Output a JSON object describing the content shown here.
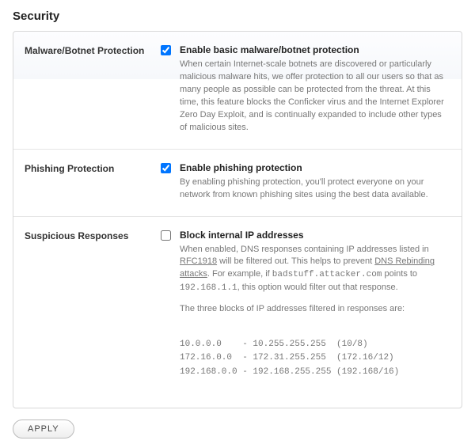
{
  "title": "Security",
  "sections": {
    "malware": {
      "label": "Malware/Botnet Protection",
      "checked": true,
      "opt_title": "Enable basic malware/botnet protection",
      "opt_desc": "When certain Internet-scale botnets are discovered or particularly malicious malware hits, we offer protection to all our users so that as many people as possible can be protected from the threat. At this time, this feature blocks the Conficker virus and the Internet Explorer Zero Day Exploit, and is continually expanded to include other types of malicious sites."
    },
    "phishing": {
      "label": "Phishing Protection",
      "checked": true,
      "opt_title": "Enable phishing protection",
      "opt_desc": "By enabling phishing protection, you'll protect everyone on your network from known phishing sites using the best data available."
    },
    "suspicious": {
      "label": "Suspicious Responses",
      "checked": false,
      "opt_title": "Block internal IP addresses",
      "desc_pre": "When enabled, DNS responses containing IP addresses listed in ",
      "rfc_link": "RFC1918",
      "desc_mid": " will be filtered out. This helps to prevent ",
      "dns_link": "DNS Rebinding attacks",
      "desc_post1": ". For example, if ",
      "example_host": "badstuff.attacker.com",
      "desc_post2": " points to ",
      "example_ip": "192.168.1.1",
      "desc_post3": ", this option would filter out that response.",
      "blocks_intro": "The three blocks of IP addresses filtered in responses are:",
      "blocks": [
        "10.0.0.0    - 10.255.255.255  (10/8)",
        "172.16.0.0  - 172.31.255.255  (172.16/12)",
        "192.168.0.0 - 192.168.255.255 (192.168/16)"
      ]
    }
  },
  "apply_label": "APPLY"
}
